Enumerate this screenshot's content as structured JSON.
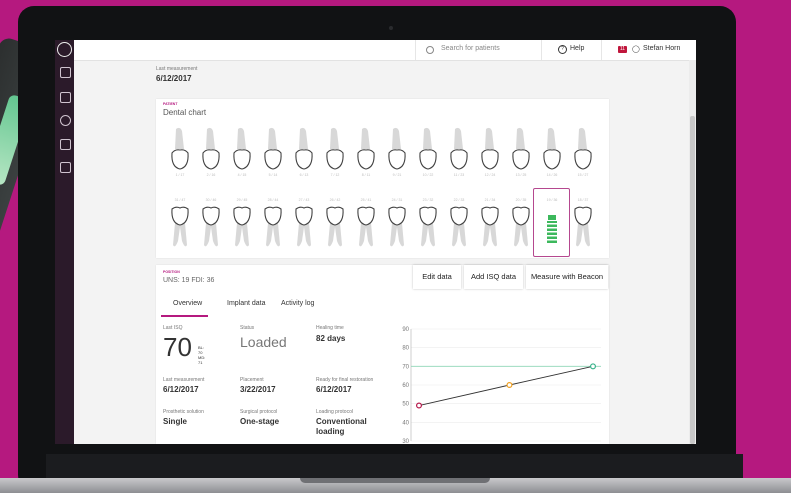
{
  "topbar": {
    "search_placeholder": "Search for patients",
    "help_label": "Help",
    "notification_count": "11",
    "user_name": "Stefan Horn"
  },
  "header": {
    "last_measurement_label": "Last measurement",
    "last_measurement_value": "6/12/2017"
  },
  "dental_chart": {
    "caption": "PATIENT",
    "title": "Dental chart",
    "upper_labels": [
      "1 / 17",
      "2 / 16",
      "4 / 15",
      "5 / 14",
      "6 / 13",
      "7 / 12",
      "8 / 11",
      "9 / 21",
      "10 / 22",
      "11 / 23",
      "12 / 24",
      "13 / 25",
      "14 / 26",
      "15 / 27"
    ],
    "lower_labels": [
      "31 / 47",
      "30 / 46",
      "29 / 45",
      "28 / 44",
      "27 / 43",
      "26 / 42",
      "25 / 41",
      "24 / 31",
      "23 / 32",
      "22 / 33",
      "21 / 34",
      "20 / 35",
      "19 / 36",
      "18 / 37"
    ],
    "selected_tooth": "19 / 36"
  },
  "position": {
    "caption": "POSITION",
    "title": "UNS: 19 FDI: 36",
    "buttons": {
      "edit": "Edit data",
      "add_isq": "Add ISQ data",
      "measure": "Measure with Beacon"
    },
    "tabs": [
      "Overview",
      "Implant data",
      "Activity log"
    ],
    "fields": {
      "last_isq_label": "Last ISQ",
      "last_isq_value": "70",
      "bl_value": "BL: 70",
      "md_value": "MD: 71",
      "status_label": "Status",
      "status_value": "Loaded",
      "healing_label": "Healing time",
      "healing_value": "82 days",
      "last_meas_label": "Last measurement",
      "last_meas_value": "6/12/2017",
      "placement_label": "Placement",
      "placement_value": "3/22/2017",
      "ready_label": "Ready for final restoration",
      "ready_value": "6/12/2017",
      "prosthetic_label": "Prosthetic solution",
      "prosthetic_value": "Single",
      "surgical_label": "Surgical protocol",
      "surgical_value": "One-stage",
      "loading_label": "Loading protocol",
      "loading_value": "Conventional loading"
    }
  },
  "chart_data": {
    "type": "line",
    "ylim": [
      30,
      90
    ],
    "yticks": [
      30,
      40,
      50,
      60,
      70,
      80,
      90
    ],
    "threshold": 70,
    "points": [
      {
        "x": 0,
        "y": 49,
        "color": "#b5194b"
      },
      {
        "x": 0.52,
        "y": 60,
        "color": "#f0a020"
      },
      {
        "x": 1,
        "y": 70,
        "color": "#37b28a"
      }
    ],
    "line_color": "#333333",
    "threshold_color": "#8fd8b8",
    "grid": true
  }
}
